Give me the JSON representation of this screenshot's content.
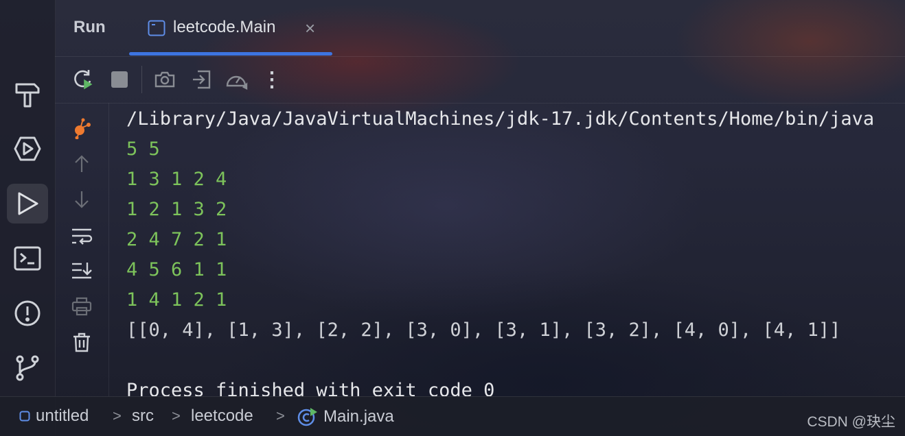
{
  "panel": {
    "title": "Run",
    "tab": {
      "label": "leetcode.Main",
      "close": "×"
    }
  },
  "toolbar": {
    "icons": [
      "rerun-icon",
      "stop-icon",
      "camera-icon",
      "exit-icon",
      "gauge-icon",
      "more-icon"
    ],
    "more_glyph": "⋮"
  },
  "left_tools": [
    "hammer-icon",
    "debug-icon",
    "run-icon",
    "terminal-icon",
    "problems-icon",
    "git-branch-icon"
  ],
  "gutter_icons": [
    "profiler-icon",
    "arrow-up-icon",
    "arrow-down-icon",
    "soft-wrap-icon",
    "scroll-to-end-icon",
    "print-icon",
    "trash-icon"
  ],
  "console": {
    "java_path": "/Library/Java/JavaVirtualMachines/jdk-17.jdk/Contents/Home/bin/java",
    "input_lines": [
      "5 5",
      "1 3 1 2 4",
      "1 2 1 3 2",
      "2 4 7 2 1",
      "4 5 6 1 1",
      "1 4 1 2 1"
    ],
    "output": "[[0, 4], [1, 3], [2, 2], [3, 0], [3, 1], [3, 2], [4, 0], [4, 1]]",
    "exit_message": "Process finished with exit code 0"
  },
  "breadcrumb": {
    "project": "untitled",
    "folder1": "src",
    "folder2": "leetcode",
    "file": "Main.java",
    "separator": ">"
  },
  "watermark": "CSDN @玦尘",
  "colors": {
    "accent": "#3d74e0",
    "input_text": "#7dc35b",
    "profiler": "#ee7a2f"
  }
}
